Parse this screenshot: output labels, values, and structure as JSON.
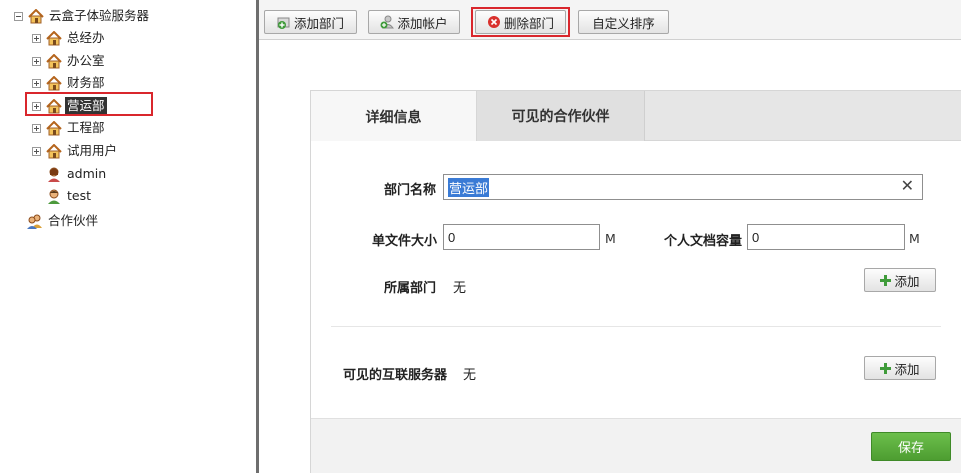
{
  "tree": {
    "root": {
      "label": "云盒子体验服务器"
    },
    "departments": [
      {
        "label": "总经办"
      },
      {
        "label": "办公室"
      },
      {
        "label": "财务部"
      },
      {
        "label": "营运部"
      },
      {
        "label": "工程部"
      },
      {
        "label": "试用用户"
      }
    ],
    "users": [
      {
        "label": "admin"
      },
      {
        "label": "test"
      }
    ],
    "partners": {
      "label": "合作伙伴"
    }
  },
  "toolbar": {
    "add_department": "添加部门",
    "add_account": "添加帐户",
    "delete_department": "删除部门",
    "custom_sort": "自定义排序"
  },
  "tabs": [
    {
      "label": "详细信息"
    },
    {
      "label": "可见的合作伙伴"
    }
  ],
  "form": {
    "dept_name_label": "部门名称",
    "dept_name_value": "营运部",
    "file_size_label": "单文件大小",
    "file_size_value": "0",
    "file_size_unit": "M",
    "quota_label": "个人文档容量",
    "quota_value": "0",
    "quota_unit": "M",
    "parent_label": "所属部门",
    "parent_value": "无",
    "add_label": "添加",
    "servers_label": "可见的互联服务器",
    "servers_value": "无",
    "servers_add_label": "添加",
    "save_label": "保存"
  },
  "colors": {
    "highlight_box": "#d9262c",
    "save_button": "#5aad3b",
    "selection": "#3a7bd5"
  }
}
